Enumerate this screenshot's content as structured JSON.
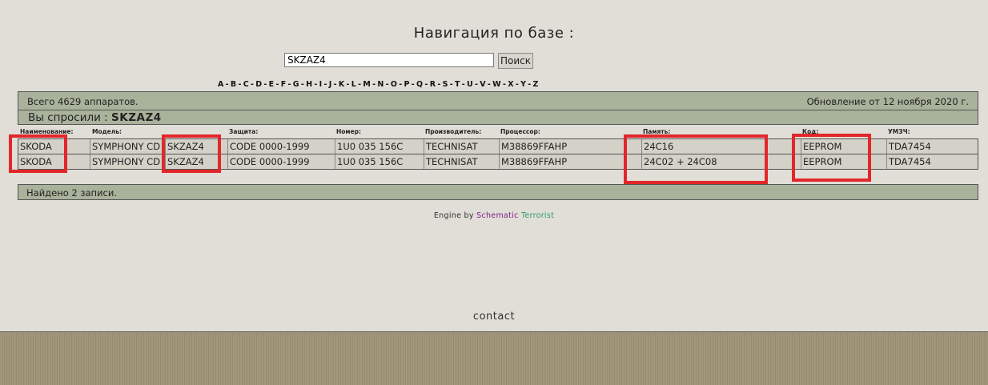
{
  "page": {
    "title": "Навигация по базе :"
  },
  "search": {
    "value": "SKZAZ4",
    "button_label": "Поиск"
  },
  "alphabet": [
    "A",
    "B",
    "C",
    "D",
    "E",
    "F",
    "G",
    "H",
    "I",
    "J",
    "K",
    "L",
    "M",
    "N",
    "O",
    "P",
    "Q",
    "R",
    "S",
    "T",
    "U",
    "V",
    "W",
    "X",
    "Y",
    "Z"
  ],
  "summary": {
    "total": "Всего 4629 аппаратов.",
    "updated": "Обновление от 12 ноября 2020 г.",
    "query_label": "Вы спросили :",
    "query_value": "SKZAZ4"
  },
  "table": {
    "columns": [
      "Наименование:",
      "Модель:",
      "Защита:",
      "Номер:",
      "Производитель:",
      "Процессор:",
      "Память:",
      "Код:",
      "УМЗЧ:"
    ],
    "rows": [
      {
        "name": "SKODA",
        "model": "SYMPHONY CD",
        "model_code": "SKZAZ4",
        "protection": "CODE 0000-1999",
        "number": "1U0 035 156C",
        "manufacturer": "TECHNISAT",
        "processor": "M38869FFAHP",
        "memory": "24C16",
        "code": "EEPROM",
        "amp": "TDA7454"
      },
      {
        "name": "SKODA",
        "model": "SYMPHONY CD",
        "model_code": "SKZAZ4",
        "protection": "CODE 0000-1999",
        "number": "1U0 035 156C",
        "manufacturer": "TECHNISAT",
        "processor": "M38869FFAHP",
        "memory": "24C02 + 24C08",
        "code": "EEPROM",
        "amp": "TDA7454"
      }
    ]
  },
  "found": "Найдено 2 записи.",
  "engine": {
    "prefix": "Engine by",
    "word1": "Schematic",
    "word2": "Terrorist"
  },
  "contact": "contact",
  "colors": {
    "background": "#e0ded6",
    "bar": "#a9b29b",
    "row": "#d4d1c8",
    "highlight": "#e2262a",
    "band": "#a3977b"
  }
}
